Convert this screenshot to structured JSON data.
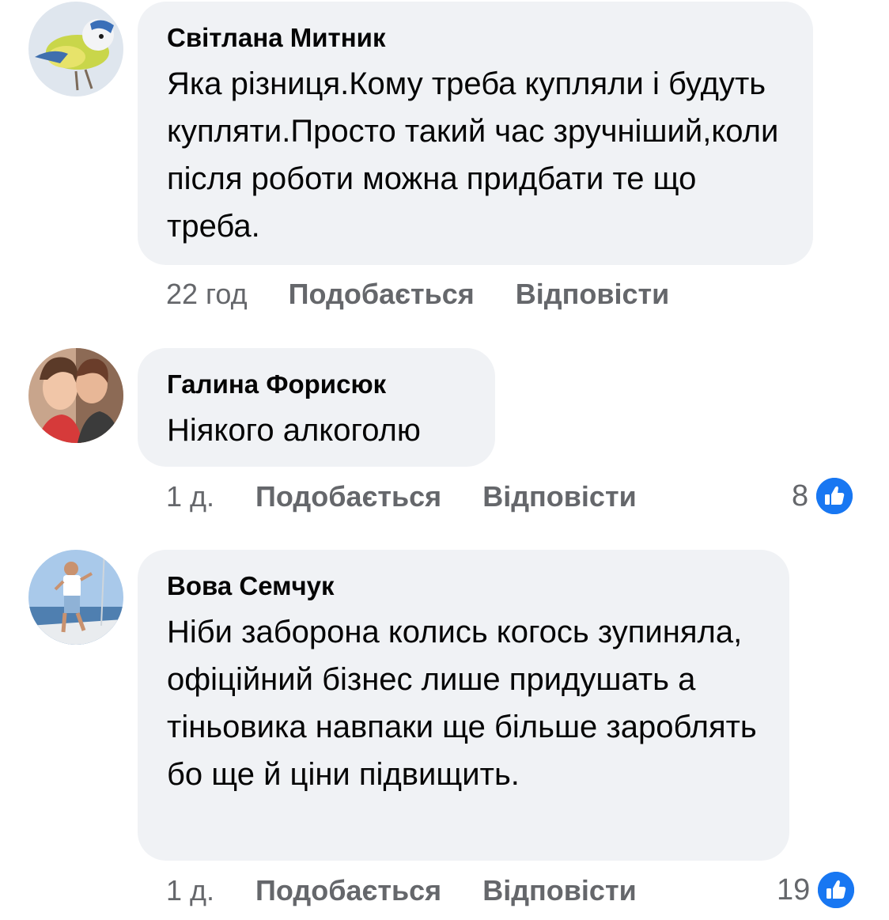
{
  "comments": [
    {
      "author": "Світлана Митник",
      "text": "Яка різниця.Кому треба купляли і будуть купляти.Просто такий час зручніший,коли після роботи можна придбати те що треба.",
      "time": "22 год",
      "like_label": "Подобається",
      "reply_label": "Відповісти",
      "reactions": null
    },
    {
      "author": "Галина Форисюк",
      "text": "Ніякого алкоголю",
      "time": "1 д.",
      "like_label": "Подобається",
      "reply_label": "Відповісти",
      "reactions": "8"
    },
    {
      "author": "Вова Семчук",
      "text": "Ніби заборона колись когось зупиняла, офіційний бізнес лише придушать а тіньовика навпаки ще більше зароблять бо ще й ціни підвищить.",
      "time": "1 д.",
      "like_label": "Подобається",
      "reply_label": "Відповісти",
      "reactions": "19"
    }
  ],
  "icons": {
    "reaction": "like-thumbs-up-icon"
  },
  "colors": {
    "bubble": "#f0f2f5",
    "meta_text": "#65676b",
    "like_blue": "#1877f2"
  }
}
